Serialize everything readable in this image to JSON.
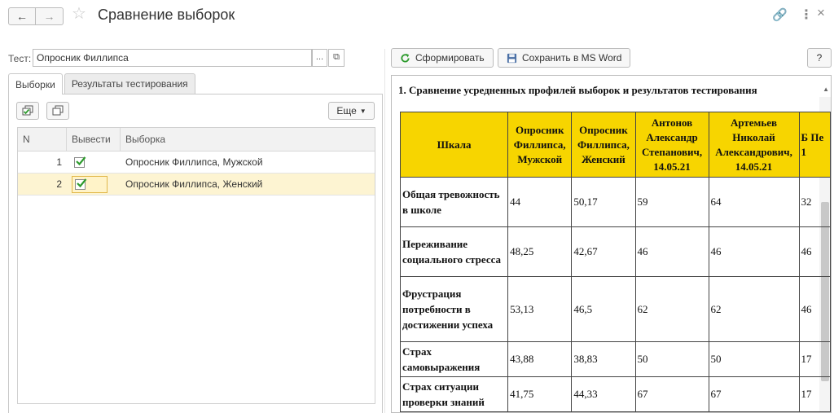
{
  "window": {
    "title": "Сравнение выборок"
  },
  "form": {
    "test_label": "Тест:",
    "test_value": "Опросник Филлипса",
    "pick_label": "...",
    "open_label": "⧉"
  },
  "tabs": [
    {
      "label": "Выборки",
      "active": true
    },
    {
      "label": "Результаты тестирования",
      "active": false
    }
  ],
  "toolbar": {
    "more_label": "Еще"
  },
  "grid": {
    "columns": [
      "N",
      "Вывести",
      "Выборка"
    ],
    "rows": [
      {
        "n": "1",
        "checked": true,
        "name": "Опросник Филлипса, Мужской",
        "selected": false
      },
      {
        "n": "2",
        "checked": true,
        "name": "Опросник Филлипса, Женский",
        "selected": true
      }
    ]
  },
  "actions": {
    "generate_label": "Сформировать",
    "save_word_label": "Сохранить в MS Word",
    "help_label": "?"
  },
  "report": {
    "title": "1. Сравнение усредненных профилей выборок и результатов тестирования",
    "headers": [
      "Шкала",
      "Опросник Филлипса, Мужской",
      "Опросник Филлипса, Женский",
      "Антонов Александр Степанович, 14.05.21",
      "Артемьев Николай Александрович, 14.05.21",
      "Б Пе 1"
    ],
    "rows": [
      {
        "scale": "Общая тревожность в школе",
        "values": [
          "44",
          "50,17",
          "59",
          "64",
          "32"
        ]
      },
      {
        "scale": "Переживание социального стресса",
        "values": [
          "48,25",
          "42,67",
          "46",
          "46",
          "46"
        ]
      },
      {
        "scale": "Фрустрация потребности в достижении успеха",
        "values": [
          "53,13",
          "46,5",
          "62",
          "62",
          "46"
        ]
      },
      {
        "scale": "Страх самовыражения",
        "values": [
          "43,88",
          "38,83",
          "50",
          "50",
          "17"
        ]
      },
      {
        "scale": "Страх ситуации проверки знаний",
        "values": [
          "41,75",
          "44,33",
          "67",
          "67",
          "17"
        ]
      }
    ]
  },
  "colors": {
    "header_fill": "#f7d500",
    "selected_row": "#fdf4d2",
    "check_green": "#2e9b2e",
    "refresh_green": "#2e9b2e"
  }
}
